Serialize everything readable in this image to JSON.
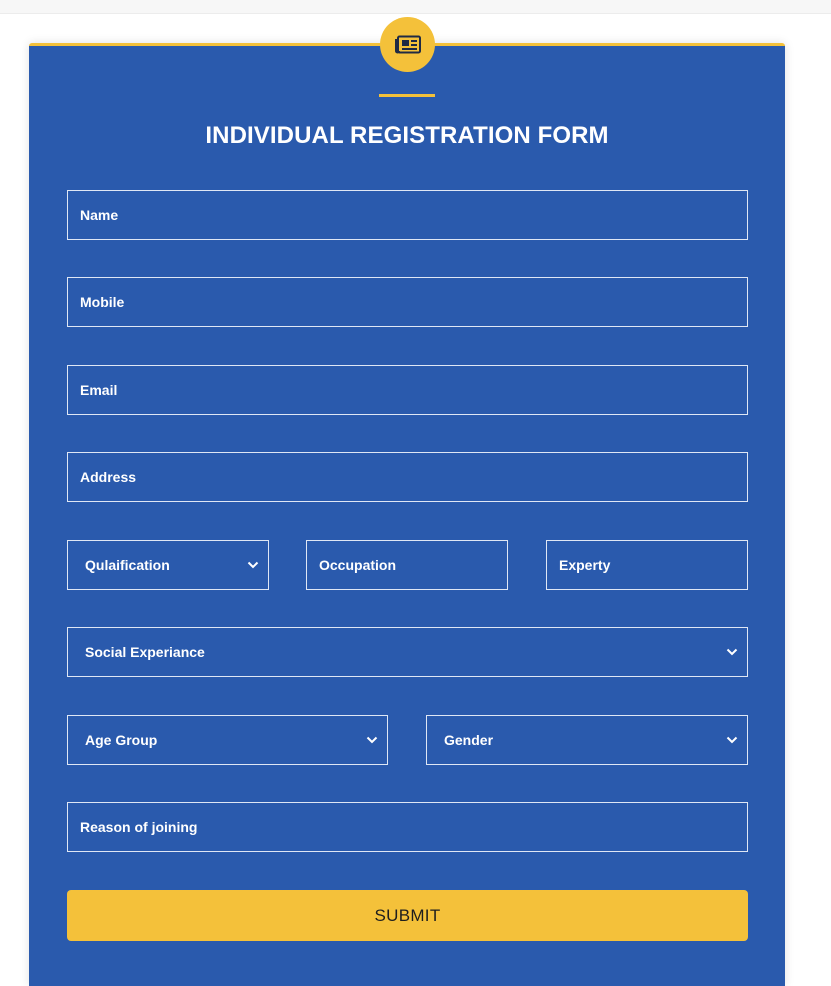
{
  "form": {
    "title": "INDIVIDUAL REGISTRATION FORM",
    "icon": "newspaper-icon",
    "colors": {
      "card": "#2a5aad",
      "accent": "#f4c13a",
      "text": "#ffffff"
    },
    "fields": {
      "name": "Name",
      "mobile": "Mobile",
      "email": "Email",
      "address": "Address",
      "qualification": "Qulaification",
      "occupation": "Occupation",
      "experty": "Experty",
      "social_experience": "Social Experiance",
      "age_group": "Age Group",
      "gender": "Gender",
      "reason": "Reason of joining"
    },
    "submit_label": "SUBMIT"
  }
}
